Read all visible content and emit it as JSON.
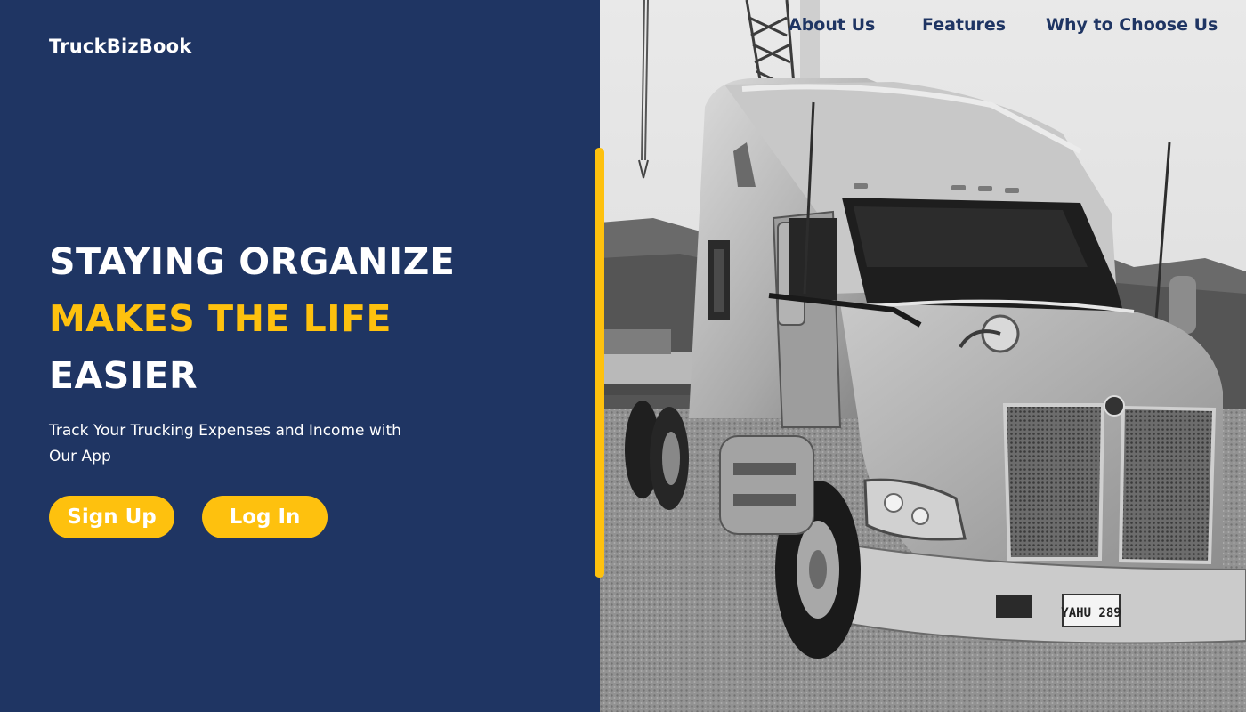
{
  "brand": {
    "name": "TruckBizBook"
  },
  "nav": {
    "items": [
      "About Us",
      "Features",
      "Why to Choose Us"
    ]
  },
  "hero": {
    "headline": [
      "STAYING ORGANIZE",
      "MAKES THE LIFE",
      "EASIER"
    ],
    "subtitle": "Track Your Trucking Expenses and Income with Our App",
    "signup_label": "Sign Up",
    "login_label": "Log In"
  },
  "photo": {
    "plate_text": "YAHU 289",
    "image_kind": "truck-photo"
  },
  "colors": {
    "navy": "#1f3563",
    "accent": "#fec10e",
    "text": "#ffffff"
  }
}
